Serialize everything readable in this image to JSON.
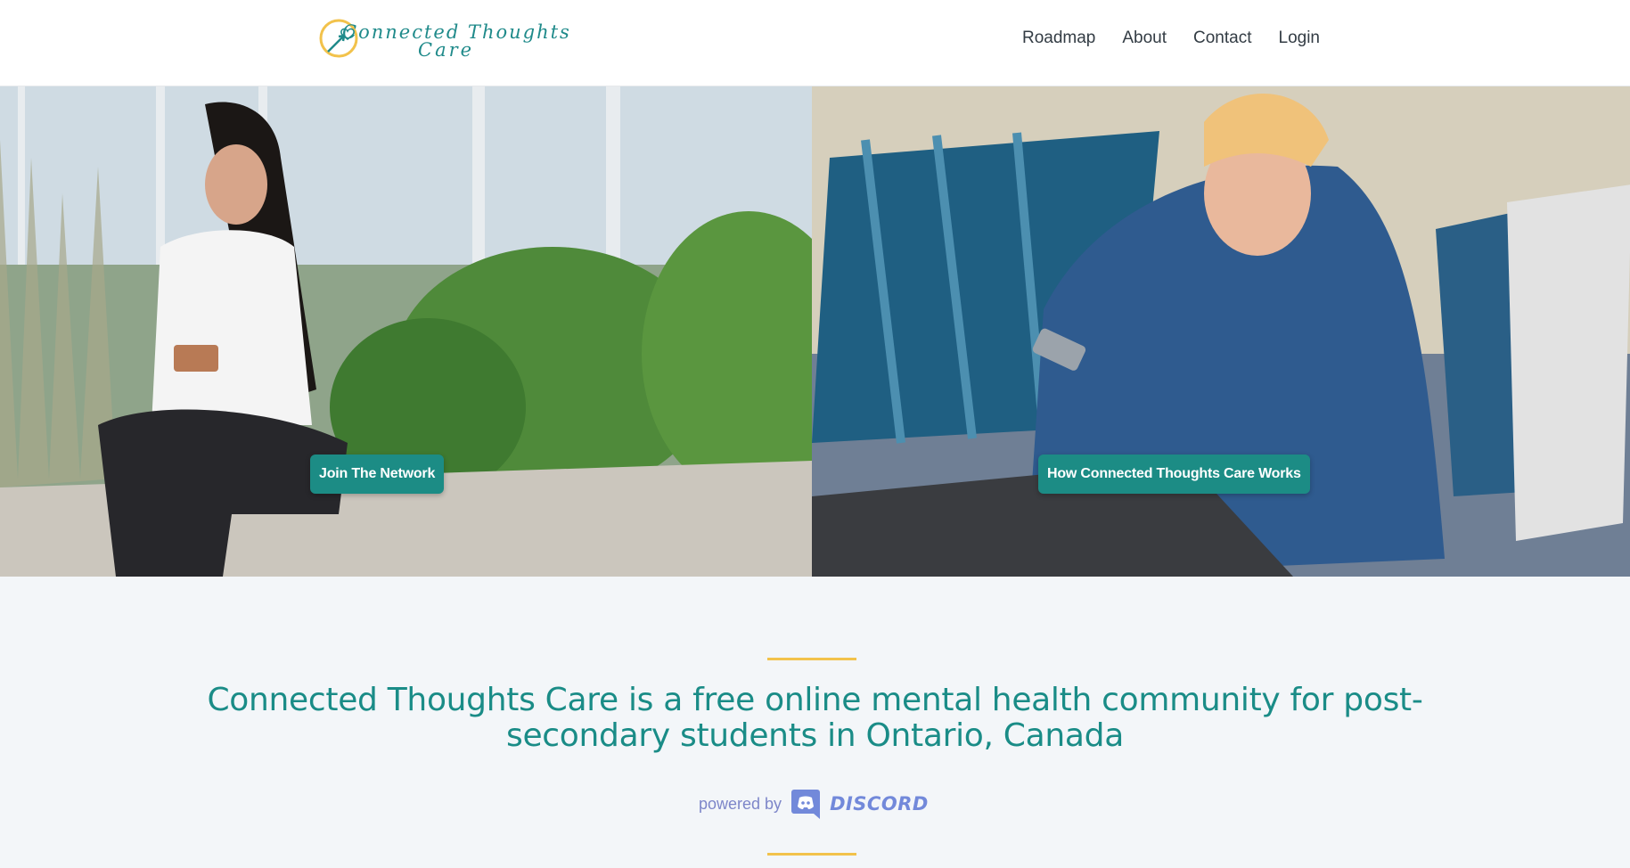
{
  "header": {
    "logo": {
      "line1": "Connected Thoughts",
      "line2": "Care",
      "icon": "heart-arrow-logo-icon"
    },
    "nav": [
      {
        "label": "Roadmap"
      },
      {
        "label": "About"
      },
      {
        "label": "Contact"
      },
      {
        "label": "Login"
      }
    ]
  },
  "hero": {
    "left_image": "woman-texting-outdoors-photo",
    "right_image": "woman-with-blanket-on-couch-photo",
    "join_button": "Join The Network",
    "how_button": "How Connected Thoughts Care Works"
  },
  "main": {
    "mission": "Connected Thoughts Care is a free online mental health community for post-secondary students in Ontario, Canada",
    "powered_by": "powered by",
    "discord_word": "DISCORD"
  },
  "colors": {
    "accent": "#1c8c85",
    "divider": "#f2c24b",
    "discord": "#7289da"
  }
}
